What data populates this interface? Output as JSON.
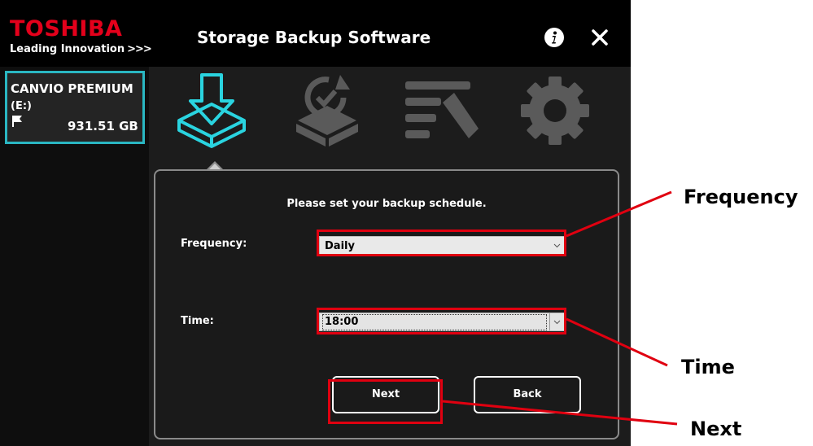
{
  "header": {
    "brand": "TOSHIBA",
    "tagline": "Leading Innovation",
    "tagline_mark": ">>>",
    "title": "Storage Backup Software",
    "info_icon": "info-icon",
    "close_icon": "close-icon"
  },
  "drive": {
    "name": "CANVIO PREMIUM",
    "letter": "(E:)",
    "size": "931.51 GB",
    "flag_icon": "flag-icon"
  },
  "tabs": [
    {
      "icon": "backup-icon",
      "active": true
    },
    {
      "icon": "restore-icon",
      "active": false
    },
    {
      "icon": "edit-settings-icon",
      "active": false
    },
    {
      "icon": "gear-icon",
      "active": false
    }
  ],
  "panel": {
    "instruction": "Please set your backup schedule.",
    "frequency_label": "Frequency:",
    "frequency_value": "Daily",
    "time_label": "Time:",
    "time_value": "18:00",
    "next_label": "Next",
    "back_label": "Back"
  },
  "callouts": {
    "frequency": "Frequency",
    "time": "Time",
    "next": "Next"
  },
  "colors": {
    "brand_red": "#e3001b",
    "accent_teal": "#2ab7c2",
    "highlight_red": "#e00010"
  }
}
